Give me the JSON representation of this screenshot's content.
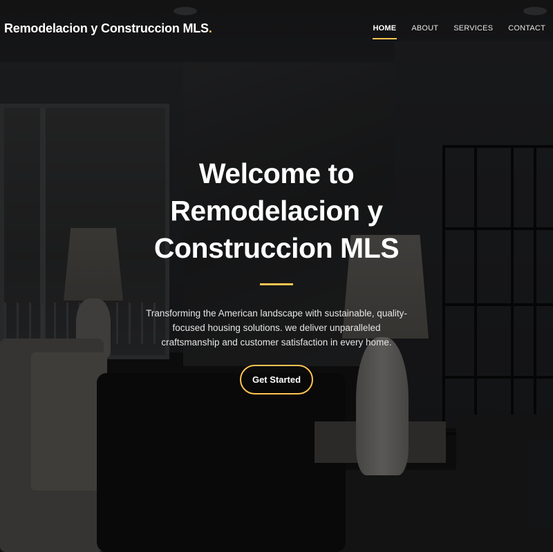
{
  "header": {
    "logo_text": "Remodelacion y Construccion MLS",
    "logo_dot": ".",
    "nav": [
      {
        "label": "HOME",
        "active": true
      },
      {
        "label": "ABOUT",
        "active": false
      },
      {
        "label": "SERVICES",
        "active": false
      },
      {
        "label": "CONTACT",
        "active": false
      }
    ]
  },
  "hero": {
    "title_line1": "Welcome to",
    "title_line2": "Remodelacion y",
    "title_line3": "Construccion MLS",
    "description": "Transforming the American landscape with sustainable, quality-focused housing solutions. we deliver unparalleled craftsmanship and customer satisfaction in every home.",
    "cta_label": "Get Started"
  },
  "colors": {
    "accent": "#ffc451",
    "text": "#ffffff",
    "overlay": "rgba(0,0,0,0.55)"
  }
}
